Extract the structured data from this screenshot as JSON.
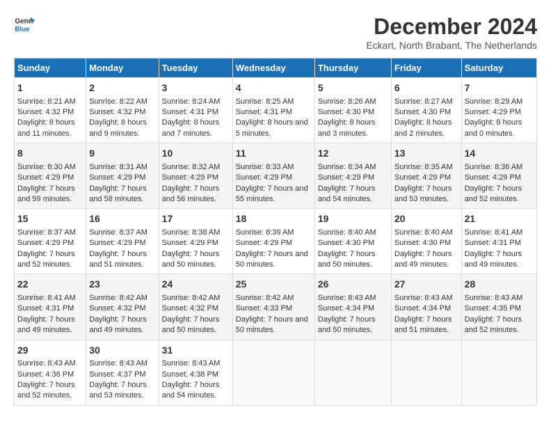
{
  "logo": {
    "line1": "General",
    "line2": "Blue"
  },
  "title": "December 2024",
  "subtitle": "Eckart, North Brabant, The Netherlands",
  "days_of_week": [
    "Sunday",
    "Monday",
    "Tuesday",
    "Wednesday",
    "Thursday",
    "Friday",
    "Saturday"
  ],
  "weeks": [
    [
      {
        "day": "1",
        "sunrise": "Sunrise: 8:21 AM",
        "sunset": "Sunset: 4:32 PM",
        "daylight": "Daylight: 8 hours and 11 minutes."
      },
      {
        "day": "2",
        "sunrise": "Sunrise: 8:22 AM",
        "sunset": "Sunset: 4:32 PM",
        "daylight": "Daylight: 8 hours and 9 minutes."
      },
      {
        "day": "3",
        "sunrise": "Sunrise: 8:24 AM",
        "sunset": "Sunset: 4:31 PM",
        "daylight": "Daylight: 8 hours and 7 minutes."
      },
      {
        "day": "4",
        "sunrise": "Sunrise: 8:25 AM",
        "sunset": "Sunset: 4:31 PM",
        "daylight": "Daylight: 8 hours and 5 minutes."
      },
      {
        "day": "5",
        "sunrise": "Sunrise: 8:26 AM",
        "sunset": "Sunset: 4:30 PM",
        "daylight": "Daylight: 8 hours and 3 minutes."
      },
      {
        "day": "6",
        "sunrise": "Sunrise: 8:27 AM",
        "sunset": "Sunset: 4:30 PM",
        "daylight": "Daylight: 8 hours and 2 minutes."
      },
      {
        "day": "7",
        "sunrise": "Sunrise: 8:29 AM",
        "sunset": "Sunset: 4:29 PM",
        "daylight": "Daylight: 8 hours and 0 minutes."
      }
    ],
    [
      {
        "day": "8",
        "sunrise": "Sunrise: 8:30 AM",
        "sunset": "Sunset: 4:29 PM",
        "daylight": "Daylight: 7 hours and 59 minutes."
      },
      {
        "day": "9",
        "sunrise": "Sunrise: 8:31 AM",
        "sunset": "Sunset: 4:29 PM",
        "daylight": "Daylight: 7 hours and 58 minutes."
      },
      {
        "day": "10",
        "sunrise": "Sunrise: 8:32 AM",
        "sunset": "Sunset: 4:29 PM",
        "daylight": "Daylight: 7 hours and 56 minutes."
      },
      {
        "day": "11",
        "sunrise": "Sunrise: 8:33 AM",
        "sunset": "Sunset: 4:29 PM",
        "daylight": "Daylight: 7 hours and 55 minutes."
      },
      {
        "day": "12",
        "sunrise": "Sunrise: 8:34 AM",
        "sunset": "Sunset: 4:29 PM",
        "daylight": "Daylight: 7 hours and 54 minutes."
      },
      {
        "day": "13",
        "sunrise": "Sunrise: 8:35 AM",
        "sunset": "Sunset: 4:29 PM",
        "daylight": "Daylight: 7 hours and 53 minutes."
      },
      {
        "day": "14",
        "sunrise": "Sunrise: 8:36 AM",
        "sunset": "Sunset: 4:29 PM",
        "daylight": "Daylight: 7 hours and 52 minutes."
      }
    ],
    [
      {
        "day": "15",
        "sunrise": "Sunrise: 8:37 AM",
        "sunset": "Sunset: 4:29 PM",
        "daylight": "Daylight: 7 hours and 52 minutes."
      },
      {
        "day": "16",
        "sunrise": "Sunrise: 8:37 AM",
        "sunset": "Sunset: 4:29 PM",
        "daylight": "Daylight: 7 hours and 51 minutes."
      },
      {
        "day": "17",
        "sunrise": "Sunrise: 8:38 AM",
        "sunset": "Sunset: 4:29 PM",
        "daylight": "Daylight: 7 hours and 50 minutes."
      },
      {
        "day": "18",
        "sunrise": "Sunrise: 8:39 AM",
        "sunset": "Sunset: 4:29 PM",
        "daylight": "Daylight: 7 hours and 50 minutes."
      },
      {
        "day": "19",
        "sunrise": "Sunrise: 8:40 AM",
        "sunset": "Sunset: 4:30 PM",
        "daylight": "Daylight: 7 hours and 50 minutes."
      },
      {
        "day": "20",
        "sunrise": "Sunrise: 8:40 AM",
        "sunset": "Sunset: 4:30 PM",
        "daylight": "Daylight: 7 hours and 49 minutes."
      },
      {
        "day": "21",
        "sunrise": "Sunrise: 8:41 AM",
        "sunset": "Sunset: 4:31 PM",
        "daylight": "Daylight: 7 hours and 49 minutes."
      }
    ],
    [
      {
        "day": "22",
        "sunrise": "Sunrise: 8:41 AM",
        "sunset": "Sunset: 4:31 PM",
        "daylight": "Daylight: 7 hours and 49 minutes."
      },
      {
        "day": "23",
        "sunrise": "Sunrise: 8:42 AM",
        "sunset": "Sunset: 4:32 PM",
        "daylight": "Daylight: 7 hours and 49 minutes."
      },
      {
        "day": "24",
        "sunrise": "Sunrise: 8:42 AM",
        "sunset": "Sunset: 4:32 PM",
        "daylight": "Daylight: 7 hours and 50 minutes."
      },
      {
        "day": "25",
        "sunrise": "Sunrise: 8:42 AM",
        "sunset": "Sunset: 4:33 PM",
        "daylight": "Daylight: 7 hours and 50 minutes."
      },
      {
        "day": "26",
        "sunrise": "Sunrise: 8:43 AM",
        "sunset": "Sunset: 4:34 PM",
        "daylight": "Daylight: 7 hours and 50 minutes."
      },
      {
        "day": "27",
        "sunrise": "Sunrise: 8:43 AM",
        "sunset": "Sunset: 4:34 PM",
        "daylight": "Daylight: 7 hours and 51 minutes."
      },
      {
        "day": "28",
        "sunrise": "Sunrise: 8:43 AM",
        "sunset": "Sunset: 4:35 PM",
        "daylight": "Daylight: 7 hours and 52 minutes."
      }
    ],
    [
      {
        "day": "29",
        "sunrise": "Sunrise: 8:43 AM",
        "sunset": "Sunset: 4:36 PM",
        "daylight": "Daylight: 7 hours and 52 minutes."
      },
      {
        "day": "30",
        "sunrise": "Sunrise: 8:43 AM",
        "sunset": "Sunset: 4:37 PM",
        "daylight": "Daylight: 7 hours and 53 minutes."
      },
      {
        "day": "31",
        "sunrise": "Sunrise: 8:43 AM",
        "sunset": "Sunset: 4:38 PM",
        "daylight": "Daylight: 7 hours and 54 minutes."
      },
      null,
      null,
      null,
      null
    ]
  ]
}
